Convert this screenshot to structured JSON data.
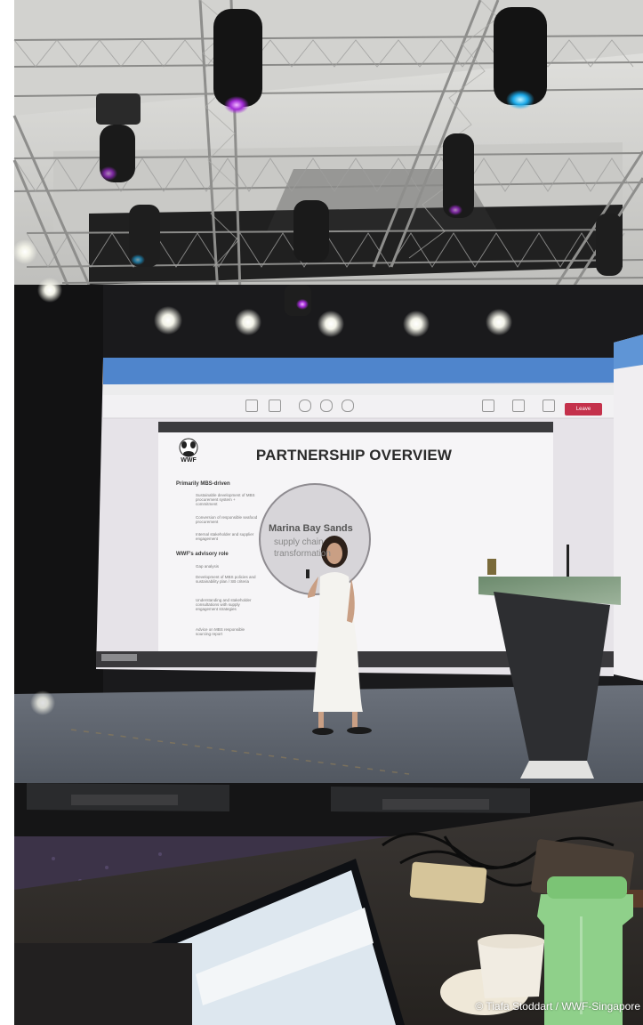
{
  "slide": {
    "logo_text": "WWF",
    "title": "PARTNERSHIP OVERVIEW",
    "section_1": "Primarily MBS-driven",
    "section_1_items": [
      "Sustainable development of MBS procurement system + commitment",
      "Conversion of responsible seafood procurement",
      "Internal stakeholder and supplier engagement"
    ],
    "section_2": "WWF's advisory role",
    "section_2_items": [
      "Gap analysis",
      "Development of MBS policies and sustainability plan / SB criteria",
      "Understanding and stakeholder consultations with supply engagement strategies",
      "Advice on MBS responsible sourcing report"
    ],
    "circle_title": "Marina Bay Sands",
    "circle_subtitle": "supply chain transformation"
  },
  "meeting_app": {
    "leave_label": "Leave",
    "toolbar_items": [
      "share-icon",
      "chat-icon",
      "people-icon",
      "react-icon",
      "view-icon",
      "camera-icon",
      "mic-icon",
      "share-screen-icon"
    ]
  },
  "credit": "© Tiafa Stoddart / WWF-Singapore",
  "colors": {
    "ceiling": "#dcdcda",
    "stage_dark": "#1c1c1e",
    "floor": "#5d646e",
    "screen_frame": "#2f77c6",
    "leave_red": "#c4314b"
  }
}
